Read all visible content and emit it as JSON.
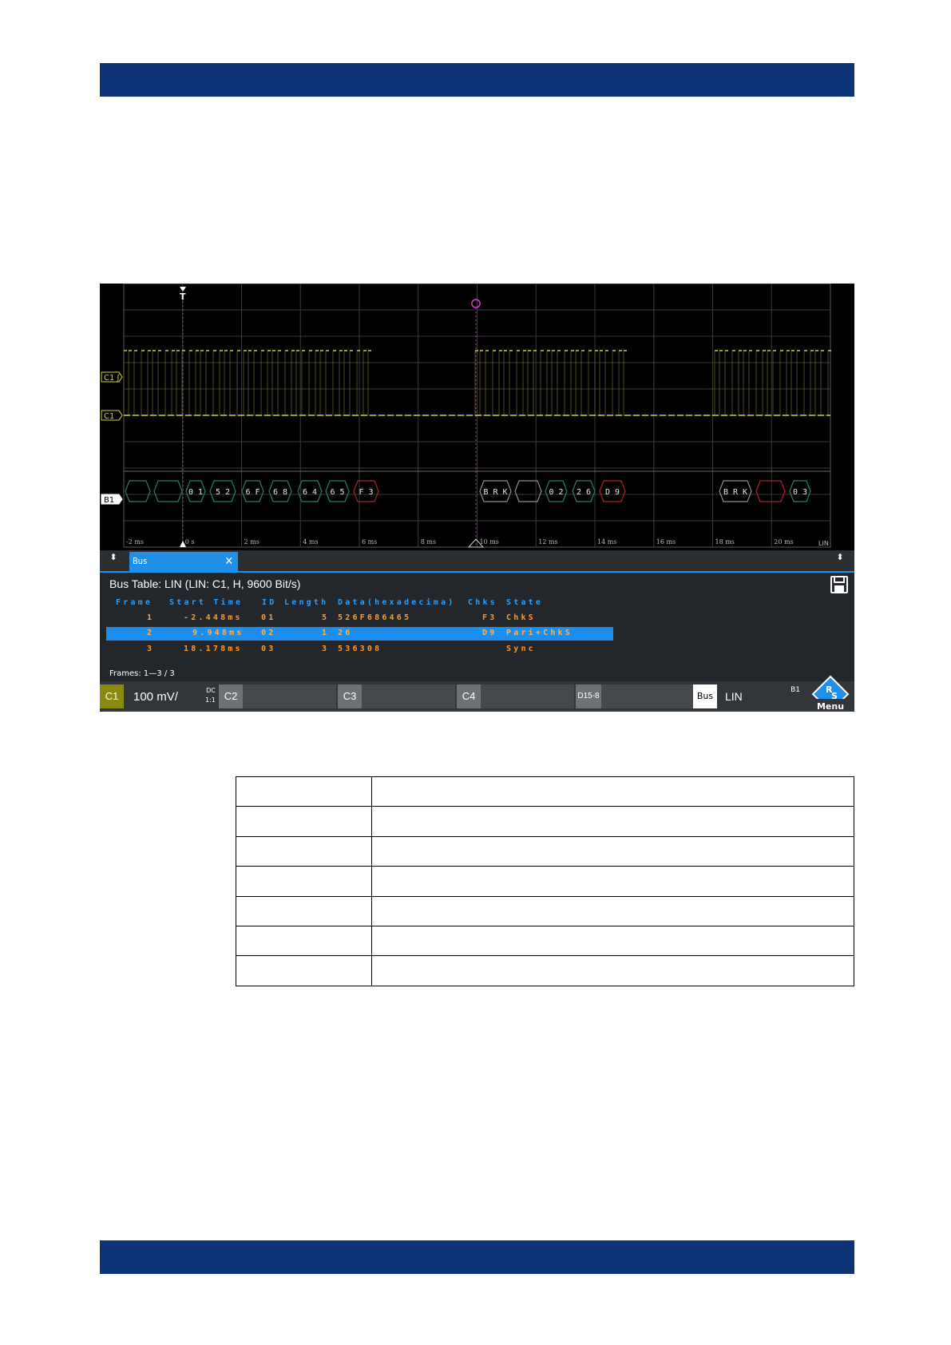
{
  "scope": {
    "x_axis": {
      "ticks": [
        "-2 ms",
        "0 s",
        "2 ms",
        "4 ms",
        "6 ms",
        "8 ms",
        "10 ms",
        "12 ms",
        "14 ms",
        "16 ms",
        "18 ms",
        "20 ms"
      ],
      "corner_label": "LIN"
    },
    "markers": {
      "trigger": "T",
      "c1_threshold": "C1 ʃ",
      "c1": "C1",
      "b1": "B1"
    },
    "decode": [
      {
        "text": "",
        "color": "#2e7d5e"
      },
      {
        "text": "",
        "color": "#2e7d5e"
      },
      {
        "text": "0 1",
        "color": "#2e7d5e"
      },
      {
        "text": "5 2",
        "color": "#2e7d5e"
      },
      {
        "text": "6 F",
        "color": "#2e7d5e"
      },
      {
        "text": "6 8",
        "color": "#2e7d5e"
      },
      {
        "text": "6 4",
        "color": "#2e7d5e"
      },
      {
        "text": "6 5",
        "color": "#2e7d5e"
      },
      {
        "text": "F 3",
        "color": "#b5202a"
      },
      {
        "text": "B R K",
        "color": "#8a8f94"
      },
      {
        "text": "",
        "color": "#8a8f94"
      },
      {
        "text": "0 2",
        "color": "#2e7d5e"
      },
      {
        "text": "2 6",
        "color": "#2e7d5e"
      },
      {
        "text": "D 9",
        "color": "#b5202a"
      },
      {
        "text": "B R K",
        "color": "#8a8f94"
      },
      {
        "text": "",
        "color": "#b5202a"
      },
      {
        "text": "0 3",
        "color": "#2e7d5e"
      }
    ]
  },
  "tabs": {
    "bus_tab": "Bus",
    "close": "✕",
    "scroll": "⬍"
  },
  "bus_table": {
    "title": "Bus Table: LIN (LIN: C1, H, 9600 Bit/s)",
    "headers": [
      "Frame",
      "Start Time",
      "ID",
      "Length",
      "Data(hexadecima)",
      "Chks",
      "State"
    ],
    "rows": [
      {
        "frame": "1",
        "start": "-2.448ms",
        "id": "01",
        "length": "5",
        "data": "526F686465",
        "chks": "F3",
        "state": "ChkS",
        "selected": false
      },
      {
        "frame": "2",
        "start": "9.948ms",
        "id": "02",
        "length": "1",
        "data": "26",
        "chks": "D9",
        "state": "Pari+ChkS",
        "selected": true
      },
      {
        "frame": "3",
        "start": "18.178ms",
        "id": "03",
        "length": "3",
        "data": "536308",
        "chks": "",
        "state": "Sync",
        "selected": false
      }
    ],
    "frames_label": "Frames:  1—3 / 3"
  },
  "status": {
    "c1": {
      "label": "C1",
      "scale": "100 mV/",
      "coupling": "DC",
      "ratio": "1:1"
    },
    "c2": {
      "label": "C2"
    },
    "c3": {
      "label": "C3"
    },
    "c4": {
      "label": "C4"
    },
    "digital": {
      "label": "D15-8"
    },
    "bus": {
      "label": "Bus",
      "protocol": "LIN",
      "tag": "B1"
    },
    "menu": "Menu"
  },
  "colors": {
    "band": "#0d3275",
    "trace": "#d2d23c",
    "accent": "#1e90e8",
    "table_text": "#ff9a2a",
    "header_text": "#2aa0ff"
  }
}
